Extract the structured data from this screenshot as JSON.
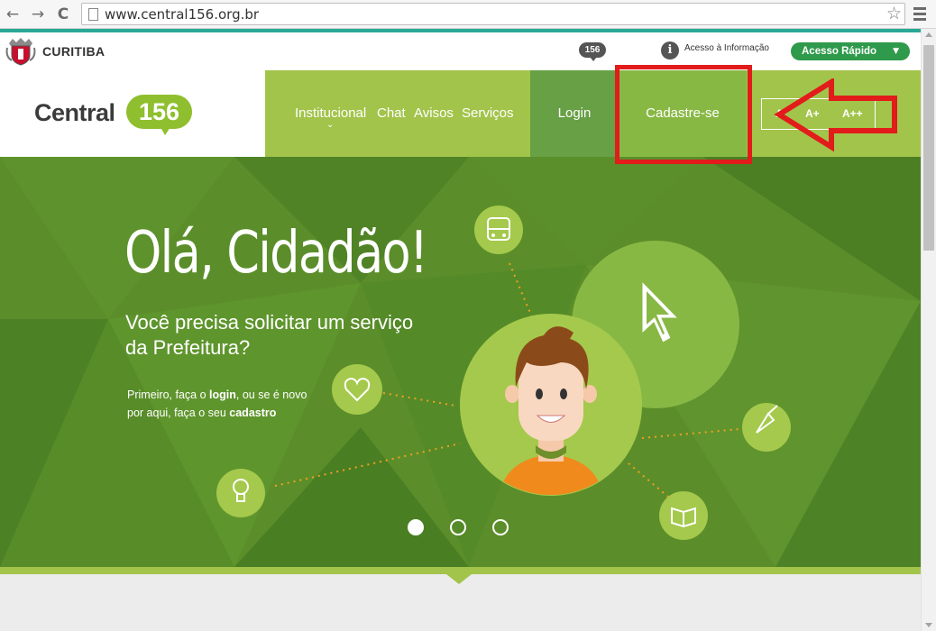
{
  "browser": {
    "url": "www.central156.org.br",
    "back_icon": "←",
    "forward_icon": "→",
    "reload_icon": "C",
    "star_icon": "☆"
  },
  "gov_bar": {
    "city": "CURITIBA",
    "bubble": "156",
    "info_icon": "i",
    "info_label": "Acesso à Informação",
    "quick_access": "Acesso Rápido",
    "quick_caret": "▼"
  },
  "logo": {
    "text": "Central",
    "number": "156"
  },
  "nav": {
    "items": [
      "Institucional",
      "Chat",
      "Avisos",
      "Serviços"
    ],
    "dropdown_chevron": "⌄",
    "login": "Login",
    "signup": "Cadastre-se",
    "font_sizes": [
      "A",
      "A+",
      "A++"
    ]
  },
  "hero": {
    "title": "Olá, Cidadão!",
    "subtitle": "Você precisa solicitar um serviço da Prefeitura?",
    "note_before_login": "Primeiro, faça o ",
    "note_login": "login",
    "note_middle": ", ou se é novo por aqui, faça o seu ",
    "note_signup": "cadastro",
    "slides": 3,
    "active_slide": 1
  },
  "colors": {
    "brand_green": "#a2c44b",
    "hero_green": "#5b8e2a",
    "login_green": "#68a046",
    "signup_green": "#88b844",
    "highlight_red": "#e21b1b",
    "quick_access_green": "#2f9a4b",
    "top_line": "#2aa897"
  }
}
